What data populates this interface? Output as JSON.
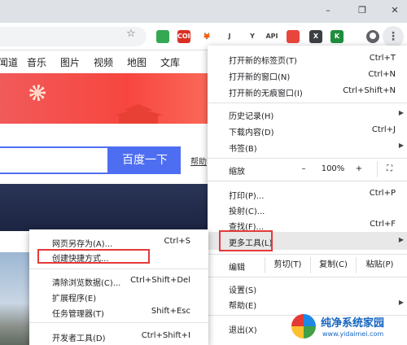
{
  "window": {
    "minimize_icon": "–",
    "restore_icon": "❐",
    "close_icon": "✕"
  },
  "toolbar": {
    "star_icon": "☆",
    "menu_icon": "⋮",
    "extensions": [
      {
        "name": "ext-green-icon",
        "label": "",
        "color": "#34a853"
      },
      {
        "name": "ext-coin-icon",
        "label": "COIN",
        "color": "#d93025"
      },
      {
        "name": "ext-fox-icon",
        "label": "🦊",
        "color": "#ffffff"
      },
      {
        "name": "ext-j-icon",
        "label": "J",
        "color": "#ffffff"
      },
      {
        "name": "ext-y-icon",
        "label": "Y",
        "color": "#ffffff"
      },
      {
        "name": "ext-api-icon",
        "label": "API",
        "color": "#ffffff"
      },
      {
        "name": "ext-flame-icon",
        "label": "",
        "color": "#e8453c"
      },
      {
        "name": "ext-x-icon",
        "label": "X",
        "color": "#3c4043"
      },
      {
        "name": "ext-excel-icon",
        "label": "K",
        "color": "#1e8e3e"
      }
    ]
  },
  "baidu": {
    "nav": [
      "闻道",
      "音乐",
      "图片",
      "视频",
      "地图",
      "文库"
    ],
    "search_button": "百度一下",
    "help_link": "帮助"
  },
  "menu": {
    "items_top": [
      {
        "label": "打开新的标签页(T)",
        "shortcut": "Ctrl+T"
      },
      {
        "label": "打开新的窗口(N)",
        "shortcut": "Ctrl+N"
      },
      {
        "label": "打开新的无痕窗口(I)",
        "shortcut": "Ctrl+Shift+N"
      }
    ],
    "history": {
      "label": "历史记录(H)",
      "arrow": "▶"
    },
    "downloads": {
      "label": "下载内容(D)",
      "shortcut": "Ctrl+J"
    },
    "bookmarks": {
      "label": "书签(B)",
      "arrow": "▶"
    },
    "zoom": {
      "label": "缩放",
      "minus": "–",
      "value": "100%",
      "plus": "+",
      "fullscreen": "⛶"
    },
    "print": {
      "label": "打印(P)...",
      "shortcut": "Ctrl+P"
    },
    "cast": {
      "label": "投射(C)..."
    },
    "find": {
      "label": "查找(F)...",
      "shortcut": "Ctrl+F"
    },
    "more_tools": {
      "label": "更多工具(L)",
      "arrow": "▶"
    },
    "edit": {
      "label": "编辑",
      "cut": "剪切(T)",
      "copy": "复制(C)",
      "paste": "粘贴(P)"
    },
    "settings": {
      "label": "设置(S)"
    },
    "help": {
      "label": "帮助(E)",
      "arrow": "▶"
    },
    "exit": {
      "label": "退出(X)"
    }
  },
  "submenu": {
    "save_page": {
      "label": "网页另存为(A)...",
      "shortcut": "Ctrl+S"
    },
    "create_shortcut": {
      "label": "创建快捷方式..."
    },
    "clear_data": {
      "label": "清除浏览数据(C)...",
      "shortcut": "Ctrl+Shift+Del"
    },
    "extensions": {
      "label": "扩展程序(E)"
    },
    "task_manager": {
      "label": "任务管理器(T)",
      "shortcut": "Shift+Esc"
    },
    "devtools": {
      "label": "开发者工具(D)",
      "shortcut": "Ctrl+Shift+I"
    }
  },
  "watermark": {
    "title": "纯净系统家园",
    "url": "www.yidaimei.com"
  }
}
